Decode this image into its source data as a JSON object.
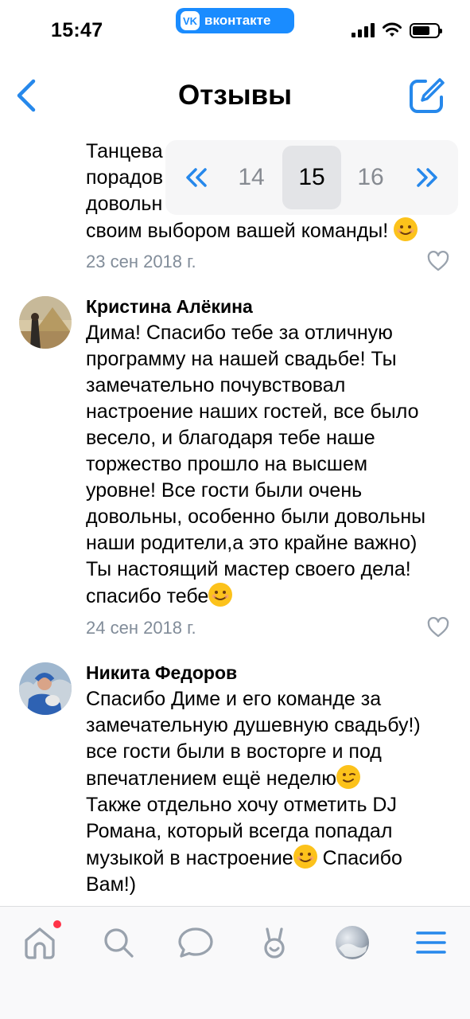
{
  "status_bar": {
    "time": "15:47",
    "app_badge": "вконтакте",
    "app_badge_logo": "VK",
    "icons": [
      "signal-icon",
      "wifi-icon",
      "battery-icon"
    ],
    "battery_level": 0.7
  },
  "header": {
    "title": "Отзывы",
    "back_icon": "chevron-left-icon",
    "edit_icon": "compose-icon",
    "accent": "#2688eb"
  },
  "pagination": {
    "first": "«",
    "prev": "14",
    "current": "15",
    "next": "16",
    "last": "»"
  },
  "reviews": [
    {
      "visible_lines": [
        "Танцева",
        "порадов",
        "довольн",
        "своим выбором вашей команды!"
      ],
      "date": "23 сен 2018 г."
    },
    {
      "author": "Кристина Алёкина",
      "lines": [
        "Дима! Спасибо тебе за отличную",
        "программу на нашей свадьбе! Ты",
        "замечательно почувствовал",
        "настроение наших гостей, все было",
        "весело, и благодаря тебе наше",
        "торжество прошло на высшем",
        "уровне! Все гости были очень",
        "довольны, особенно были довольны",
        "наши родители,а это крайне важно)",
        "Ты настоящий мастер своего дела!",
        "спасибо тебе"
      ],
      "date": "24 сен 2018 г."
    },
    {
      "author": "Никита Федоров",
      "lines": [
        "Спасибо Диме и его команде за",
        "замечательную душевную свадьбу!)",
        "все гости были в восторге и под",
        "впечатлением ещё неделю",
        "Также отдельно хочу отметить DJ",
        "Романа, который всегда попадал",
        "музыкой в настроение",
        "Вам!)"
      ],
      "after_emoji": " Спасибо"
    }
  ],
  "tab_bar": {
    "tabs": [
      "home-icon",
      "search-icon",
      "messages-icon",
      "services-icon",
      "profile-avatar",
      "menu-icon"
    ],
    "notification_color": "#ff3347"
  }
}
